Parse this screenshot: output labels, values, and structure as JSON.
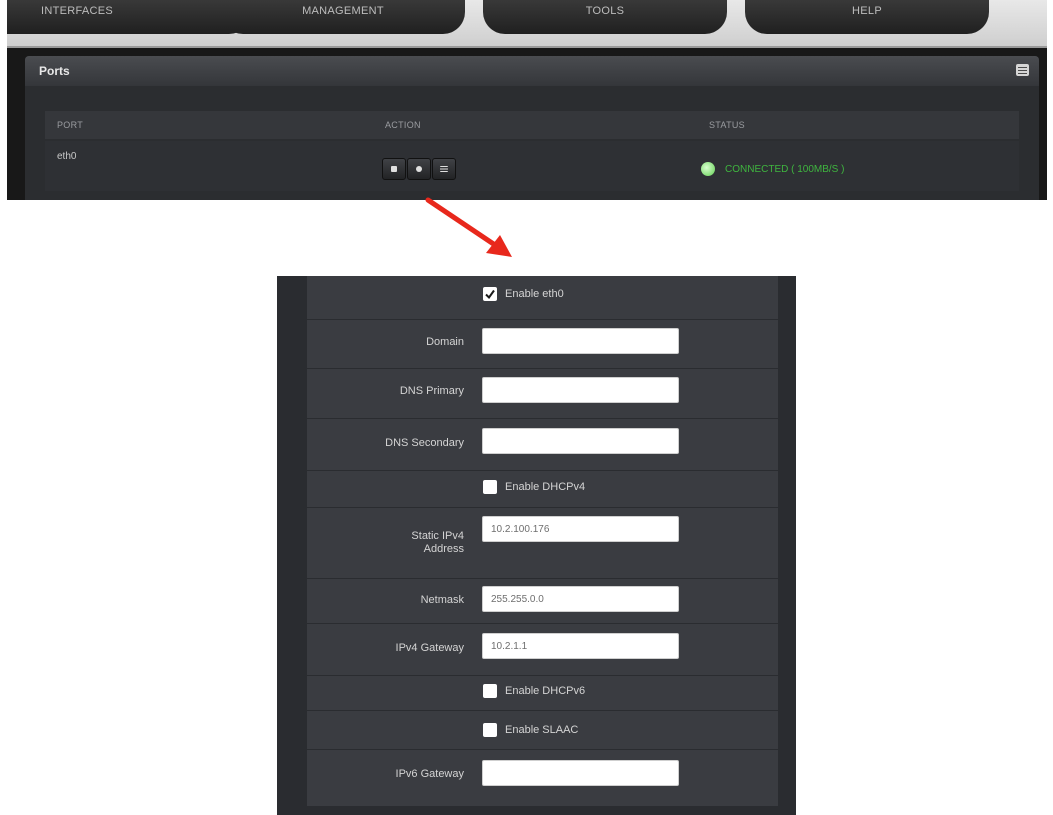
{
  "nav": {
    "tabs": [
      "INTERFACES",
      "MANAGEMENT",
      "TOOLS",
      "HELP"
    ]
  },
  "ports_panel": {
    "title": "Ports",
    "columns": [
      "PORT",
      "ACTION",
      "STATUS"
    ],
    "rows": [
      {
        "port": "eth0",
        "status": "CONNECTED ( 100MB/S )",
        "status_color": "#3fb53f"
      }
    ],
    "action_icons": [
      "square-icon",
      "circle-icon",
      "list-icon"
    ]
  },
  "arrow_color": "#e8281c",
  "config_form": {
    "enable_eth0": {
      "label": "Enable eth0",
      "checked": true
    },
    "domain": {
      "label": "Domain",
      "value": ""
    },
    "dns_primary": {
      "label": "DNS Primary",
      "value": ""
    },
    "dns_secondary": {
      "label": "DNS Secondary",
      "value": ""
    },
    "enable_dhcpv4": {
      "label": "Enable DHCPv4",
      "checked": false
    },
    "static_ipv4": {
      "label_line1": "Static IPv4",
      "label_line2": "Address",
      "value": "10.2.100.176"
    },
    "netmask": {
      "label": "Netmask",
      "value": "255.255.0.0"
    },
    "ipv4_gateway": {
      "label": "IPv4 Gateway",
      "value": "10.2.1.1"
    },
    "enable_dhcpv6": {
      "label": "Enable DHCPv6",
      "checked": false
    },
    "enable_slaac": {
      "label": "Enable SLAAC",
      "checked": false
    },
    "ipv6_gateway": {
      "label": "IPv6 Gateway",
      "value": ""
    }
  }
}
